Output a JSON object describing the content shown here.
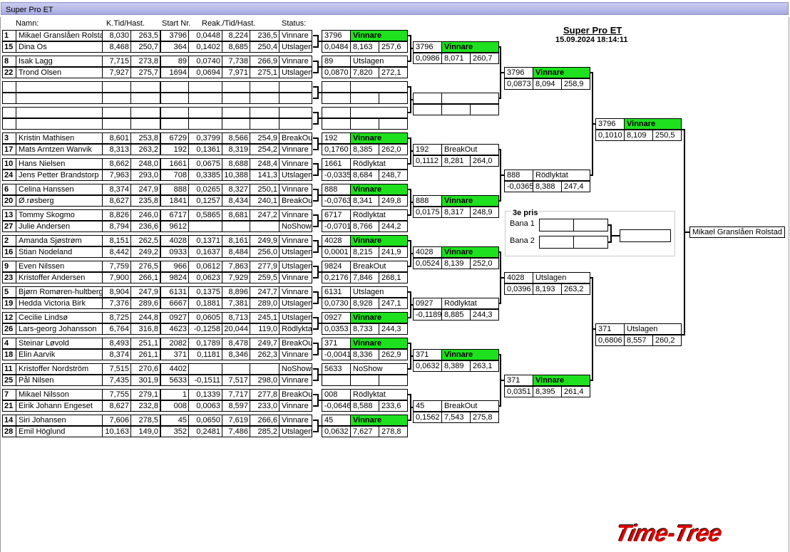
{
  "window_title": "Super Pro ET",
  "columns": [
    "Namn:",
    "K.Tid/Hast.",
    "Start Nr.",
    "Reak./Tid/Hast.",
    "Status:"
  ],
  "event": {
    "title": "Super Pro ET",
    "datetime": "15.09.2024 18:14:11"
  },
  "rounds": {
    "r1": [
      {
        "seed": "1",
        "name": "Mikael Granslåen Rolstad",
        "kt": "8,030",
        "hast": "263,5",
        "nr": "3796",
        "reak": "0,0448",
        "tid": "8,224",
        "h2": "236,5",
        "status": "Vinnare"
      },
      {
        "seed": "15",
        "name": "Dina Os",
        "kt": "8,468",
        "hast": "250,7",
        "nr": "364",
        "reak": "0,1402",
        "tid": "8,685",
        "h2": "250,4",
        "status": "Utslagen"
      },
      {
        "seed": "8",
        "name": "Isak Lagg",
        "kt": "7,715",
        "hast": "273,8",
        "nr": "89",
        "reak": "0,0740",
        "tid": "7,738",
        "h2": "266,9",
        "status": "Vinnare"
      },
      {
        "seed": "22",
        "name": "Trond Olsen",
        "kt": "7,927",
        "hast": "275,7",
        "nr": "1694",
        "reak": "0,0694",
        "tid": "7,971",
        "h2": "275,1",
        "status": "Utslagen"
      },
      {
        "seed": "",
        "name": "",
        "kt": "",
        "hast": "",
        "nr": "",
        "reak": "",
        "tid": "",
        "h2": "",
        "status": ""
      },
      {
        "seed": "",
        "name": "",
        "kt": "",
        "hast": "",
        "nr": "",
        "reak": "",
        "tid": "",
        "h2": "",
        "status": ""
      },
      {
        "seed": "",
        "name": "",
        "kt": "",
        "hast": "",
        "nr": "",
        "reak": "",
        "tid": "",
        "h2": "",
        "status": ""
      },
      {
        "seed": "",
        "name": "",
        "kt": "",
        "hast": "",
        "nr": "",
        "reak": "",
        "tid": "",
        "h2": "",
        "status": ""
      },
      {
        "seed": "3",
        "name": "Kristin Mathisen",
        "kt": "8,601",
        "hast": "253,8",
        "nr": "6729",
        "reak": "0,3799",
        "tid": "8,566",
        "h2": "254,9",
        "status": "BreakOut"
      },
      {
        "seed": "17",
        "name": "Mats Arntzen Wanvik",
        "kt": "8,313",
        "hast": "263,2",
        "nr": "192",
        "reak": "0,1361",
        "tid": "8,319",
        "h2": "254,2",
        "status": "Vinnare"
      },
      {
        "seed": "10",
        "name": "Hans Nielsen",
        "kt": "8,662",
        "hast": "248,0",
        "nr": "1661",
        "reak": "0,0675",
        "tid": "8,688",
        "h2": "248,4",
        "status": "Vinnare"
      },
      {
        "seed": "24",
        "name": "Jens Petter  Brandstorp",
        "kt": "7,963",
        "hast": "293,0",
        "nr": "708",
        "reak": "0,3385",
        "tid": "10,388",
        "h2": "141,3",
        "status": "Utslagen"
      },
      {
        "seed": "6",
        "name": "Celina Hanssen",
        "kt": "8,374",
        "hast": "247,9",
        "nr": "888",
        "reak": "0,0265",
        "tid": "8,327",
        "h2": "250,1",
        "status": "Vinnare"
      },
      {
        "seed": "20",
        "name": "Ø.røsberg",
        "kt": "8,627",
        "hast": "235,8",
        "nr": "1841",
        "reak": "0,1257",
        "tid": "8,434",
        "h2": "240,1",
        "status": "BreakOut"
      },
      {
        "seed": "13",
        "name": "Tommy Skogmo",
        "kt": "8,826",
        "hast": "246,0",
        "nr": "6717",
        "reak": "0,5865",
        "tid": "8,681",
        "h2": "247,2",
        "status": "Vinnare"
      },
      {
        "seed": "27",
        "name": "Julie  Andersen",
        "kt": "8,794",
        "hast": "236,6",
        "nr": "9612",
        "reak": "",
        "tid": "",
        "h2": "",
        "status": "NoShow"
      },
      {
        "seed": "2",
        "name": "Amanda Sjøstrøm",
        "kt": "8,151",
        "hast": "262,5",
        "nr": "4028",
        "reak": "0,1371",
        "tid": "8,161",
        "h2": "249,9",
        "status": "Vinnare"
      },
      {
        "seed": "16",
        "name": "Stian Nodeland",
        "kt": "8,442",
        "hast": "249,2",
        "nr": "0933",
        "reak": "0,1637",
        "tid": "8,484",
        "h2": "256,0",
        "status": "Utslagen"
      },
      {
        "seed": "9",
        "name": "Even Nilssen",
        "kt": "7,759",
        "hast": "276,5",
        "nr": "966",
        "reak": "0,0612",
        "tid": "7,863",
        "h2": "277,9",
        "status": "Utslagen"
      },
      {
        "seed": "23",
        "name": "Kristoffer Andersen",
        "kt": "7,900",
        "hast": "266,1",
        "nr": "9824",
        "reak": "0,0623",
        "tid": "7,929",
        "h2": "259,5",
        "status": "Vinnare"
      },
      {
        "seed": "5",
        "name": "Bjørn Romøren-hultberg",
        "kt": "8,904",
        "hast": "247,9",
        "nr": "6131",
        "reak": "0,1375",
        "tid": "8,896",
        "h2": "247,7",
        "status": "Vinnare"
      },
      {
        "seed": "19",
        "name": "Hedda Victoria Birk",
        "kt": "7,376",
        "hast": "289,6",
        "nr": "6667",
        "reak": "0,1881",
        "tid": "7,381",
        "h2": "289,0",
        "status": "Utslagen"
      },
      {
        "seed": "12",
        "name": "Cecilie Lindsø",
        "kt": "8,725",
        "hast": "244,8",
        "nr": "0927",
        "reak": "0,0605",
        "tid": "8,713",
        "h2": "245,1",
        "status": "Utslagen"
      },
      {
        "seed": "26",
        "name": "Lars-georg Johansson",
        "kt": "6,764",
        "hast": "316,8",
        "nr": "4623",
        "reak": "-0,1258",
        "tid": "20,044",
        "h2": "119,0",
        "status": "Rödlyktat"
      },
      {
        "seed": "4",
        "name": "Steinar Løvold",
        "kt": "8,493",
        "hast": "251,1",
        "nr": "2082",
        "reak": "0,1789",
        "tid": "8,478",
        "h2": "249,7",
        "status": "BreakOut"
      },
      {
        "seed": "18",
        "name": "Elin Aarvik",
        "kt": "8,374",
        "hast": "261,1",
        "nr": "371",
        "reak": "0,1181",
        "tid": "8,346",
        "h2": "262,3",
        "status": "Vinnare"
      },
      {
        "seed": "11",
        "name": "Kristoffer Nordström",
        "kt": "7,515",
        "hast": "270,6",
        "nr": "4402",
        "reak": "",
        "tid": "",
        "h2": "",
        "status": "NoShow"
      },
      {
        "seed": "25",
        "name": "Pål Nilsen",
        "kt": "7,435",
        "hast": "301,9",
        "nr": "5633",
        "reak": "-0,1511",
        "tid": "7,517",
        "h2": "298,0",
        "status": "Vinnare"
      },
      {
        "seed": "7",
        "name": "Mikael Nilsson",
        "kt": "7,755",
        "hast": "279,1",
        "nr": "1",
        "reak": "0,1339",
        "tid": "7,717",
        "h2": "277,8",
        "status": "BreakOut"
      },
      {
        "seed": "21",
        "name": "Eirik Johann Engeset",
        "kt": "8,627",
        "hast": "232,8",
        "nr": "008",
        "reak": "0,0063",
        "tid": "8,597",
        "h2": "233,0",
        "status": "Vinnare"
      },
      {
        "seed": "14",
        "name": "Siri Johansen",
        "kt": "7,606",
        "hast": "278,5",
        "nr": "45",
        "reak": "0,0650",
        "tid": "7,619",
        "h2": "266,6",
        "status": "Vinnare"
      },
      {
        "seed": "28",
        "name": "Emil Höglund",
        "kt": "10,163",
        "hast": "149,0",
        "nr": "352",
        "reak": "0,2481",
        "tid": "7,486",
        "h2": "285,2",
        "status": "Utslagen"
      }
    ],
    "r2": [
      {
        "nr": "3796",
        "status": "Vinnare",
        "reak": "0,0484",
        "tid": "8,163",
        "h": "257,6"
      },
      {
        "nr": "89",
        "status": "Utslagen",
        "reak": "0,0870",
        "tid": "7,820",
        "h": "272,1"
      },
      {
        "nr": "",
        "status": "",
        "reak": "",
        "tid": "",
        "h": ""
      },
      {
        "nr": "",
        "status": "",
        "reak": "",
        "tid": "",
        "h": ""
      },
      {
        "nr": "192",
        "status": "Vinnare",
        "reak": "0,1760",
        "tid": "8,385",
        "h": "262,0"
      },
      {
        "nr": "1661",
        "status": "Rödlyktat",
        "reak": "-0,0335",
        "tid": "8,684",
        "h": "248,7"
      },
      {
        "nr": "888",
        "status": "Vinnare",
        "reak": "-0,0763",
        "tid": "8,341",
        "h": "249,8"
      },
      {
        "nr": "6717",
        "status": "Rödlyktat",
        "reak": "-0,0701",
        "tid": "8,766",
        "h": "244,2"
      },
      {
        "nr": "4028",
        "status": "Vinnare",
        "reak": "0,0001",
        "tid": "8,215",
        "h": "241,9"
      },
      {
        "nr": "9824",
        "status": "BreakOut",
        "reak": "0,2176",
        "tid": "7,846",
        "h": "268,1"
      },
      {
        "nr": "6131",
        "status": "Utslagen",
        "reak": "0,0730",
        "tid": "8,928",
        "h": "247,1"
      },
      {
        "nr": "0927",
        "status": "Vinnare",
        "reak": "0,0353",
        "tid": "8,733",
        "h": "244,3"
      },
      {
        "nr": "371",
        "status": "Vinnare",
        "reak": "-0,0041",
        "tid": "8,336",
        "h": "262,9"
      },
      {
        "nr": "5633",
        "status": "NoShow",
        "reak": "",
        "tid": "",
        "h": ""
      },
      {
        "nr": "008",
        "status": "Rödlyktat",
        "reak": "-0,0646",
        "tid": "8,588",
        "h": "233,6"
      },
      {
        "nr": "45",
        "status": "Vinnare",
        "reak": "0,0632",
        "tid": "7,627",
        "h": "278,8"
      }
    ],
    "r3": [
      {
        "nr": "3796",
        "status": "Vinnare",
        "reak": "0,0986",
        "tid": "8,071",
        "h": "260,7"
      },
      {
        "nr": "",
        "status": "",
        "reak": "",
        "tid": "",
        "h": ""
      },
      {
        "nr": "192",
        "status": "BreakOut",
        "reak": "0,1112",
        "tid": "8,281",
        "h": "264,0"
      },
      {
        "nr": "888",
        "status": "Vinnare",
        "reak": "0,0175",
        "tid": "8,317",
        "h": "248,9"
      },
      {
        "nr": "4028",
        "status": "Vinnare",
        "reak": "0,0524",
        "tid": "8,139",
        "h": "252,0"
      },
      {
        "nr": "0927",
        "status": "Rödlyktat",
        "reak": "-0,1189",
        "tid": "8,885",
        "h": "244,3"
      },
      {
        "nr": "371",
        "status": "Vinnare",
        "reak": "0,0632",
        "tid": "8,389",
        "h": "263,1"
      },
      {
        "nr": "45",
        "status": "BreakOut",
        "reak": "0,1562",
        "tid": "7,543",
        "h": "275,8"
      }
    ],
    "r4": [
      {
        "nr": "3796",
        "status": "Vinnare",
        "reak": "0,0873",
        "tid": "8,094",
        "h": "258,9"
      },
      {
        "nr": "888",
        "status": "Rödlyktat",
        "reak": "-0,0365",
        "tid": "8,388",
        "h": "247,4"
      },
      {
        "nr": "4028",
        "status": "Utslagen",
        "reak": "0,0396",
        "tid": "8,193",
        "h": "263,2"
      },
      {
        "nr": "371",
        "status": "Vinnare",
        "reak": "0,0351",
        "tid": "8,395",
        "h": "261,4"
      }
    ],
    "r5": [
      {
        "nr": "3796",
        "status": "Vinnare",
        "reak": "0,1010",
        "tid": "8,109",
        "h": "250,5"
      },
      {
        "nr": "371",
        "status": "Utslagen",
        "reak": "0,6806",
        "tid": "8,557",
        "h": "260,2"
      }
    ]
  },
  "third_place": {
    "title": "3e pris",
    "lane1": "Bana 1",
    "lane2": "Bana 2"
  },
  "champion": "Mikael Granslåen Rolstad",
  "logo_text": "Time-Tree",
  "colors": {
    "winner": "#1fe01f",
    "logo": "#e00000",
    "titlebar": "#b6b8ea"
  }
}
